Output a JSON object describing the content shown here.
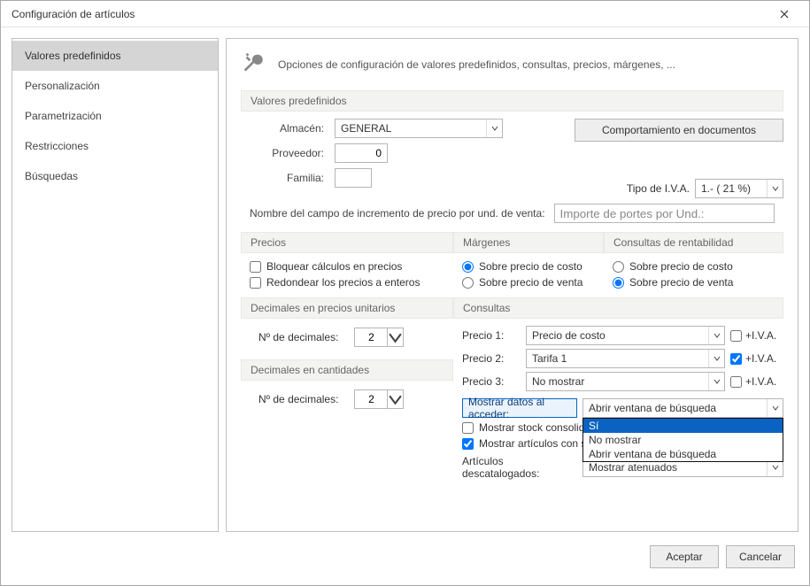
{
  "window": {
    "title": "Configuración de artículos"
  },
  "sidebar": {
    "items": [
      {
        "label": "Valores predefinidos",
        "active": true
      },
      {
        "label": "Personalización"
      },
      {
        "label": "Parametrización"
      },
      {
        "label": "Restricciones"
      },
      {
        "label": "Búsquedas"
      }
    ]
  },
  "header": {
    "desc": "Opciones de configuración de valores predefinidos, consultas, precios, márgenes, ..."
  },
  "groups": {
    "valores": "Valores predefinidos",
    "precios": "Precios",
    "margenes": "Márgenes",
    "rentabilidad": "Consultas de rentabilidad",
    "dec_unit": "Decimales en precios unitarios",
    "dec_cant": "Decimales en cantidades",
    "consultas": "Consultas"
  },
  "valores": {
    "almacen_label": "Almacén:",
    "almacen_value": "GENERAL",
    "proveedor_label": "Proveedor:",
    "proveedor_value": "0",
    "familia_label": "Familia:",
    "familia_value": "",
    "comport_btn": "Comportamiento en documentos",
    "iva_label": "Tipo de I.V.A.",
    "iva_value": "1.- ( 21 %)",
    "increment_label": "Nombre del campo de incremento de precio por und. de venta:",
    "increment_value": "Importe de portes por Und.:"
  },
  "precios": {
    "bloquear": "Bloquear cálculos en precios",
    "redondear": "Redondear los precios a enteros"
  },
  "margenes": {
    "costo": "Sobre precio de costo",
    "venta": "Sobre precio de venta"
  },
  "rentab": {
    "costo": "Sobre precio de costo",
    "venta": "Sobre precio de venta"
  },
  "decimales": {
    "label": "Nº de decimales:",
    "unit_value": "2",
    "cant_value": "2"
  },
  "consultas": {
    "precio1_label": "Precio 1:",
    "precio1_value": "Precio de costo",
    "precio1_iva": "+I.V.A.",
    "precio2_label": "Precio 2:",
    "precio2_value": "Tarifa 1",
    "precio2_iva": "+I.V.A.",
    "precio3_label": "Precio 3:",
    "precio3_value": "No mostrar",
    "precio3_iva": "+I.V.A.",
    "mostrar_label": "Mostrar datos al acceder:",
    "mostrar_value": "Abrir ventana de búsqueda",
    "mostrar_options": [
      "Sí",
      "No mostrar",
      "Abrir ventana de búsqueda"
    ],
    "stock_consol": "Mostrar stock consolida",
    "articulos_sto": "Mostrar artículos con st",
    "descat_label": "Artículos descatalogados:",
    "descat_value": "Mostrar atenuados"
  },
  "footer": {
    "ok": "Aceptar",
    "cancel": "Cancelar"
  }
}
